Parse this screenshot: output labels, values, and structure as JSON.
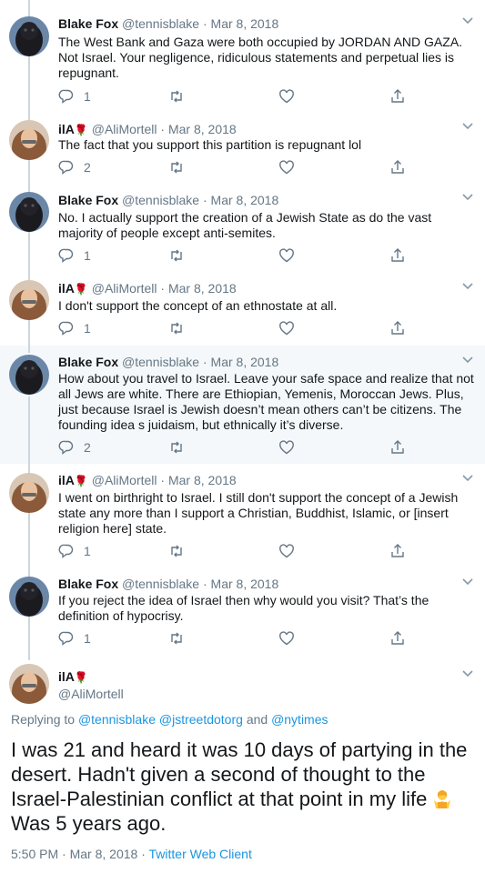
{
  "tweets": [
    {
      "name": "Blake Fox",
      "handle": "@tennisblake",
      "date": "Mar 8, 2018",
      "text": "The West Bank and Gaza were both occupied by JORDAN AND GAZA. Not Israel. Your negligence, ridiculous statements and perpetual lies is repugnant.",
      "replies": "1",
      "retweets": "",
      "likes": ""
    },
    {
      "name": "ilA",
      "name_emoji": "rose",
      "handle": "@AliMortell",
      "date": "Mar 8, 2018",
      "text": "The fact that you support this partition is repugnant lol",
      "replies": "2",
      "retweets": "",
      "likes": ""
    },
    {
      "name": "Blake Fox",
      "handle": "@tennisblake",
      "date": "Mar 8, 2018",
      "text": "No. I actually support the creation of a Jewish State as do the vast majority of people except anti-semites.",
      "replies": "1",
      "retweets": "",
      "likes": ""
    },
    {
      "name": "ilA",
      "name_emoji": "rose",
      "handle": "@AliMortell",
      "date": "Mar 8, 2018",
      "text": "I don't support the concept of an ethnostate at all.",
      "replies": "1",
      "retweets": "",
      "likes": ""
    },
    {
      "name": "Blake Fox",
      "handle": "@tennisblake",
      "date": "Mar 8, 2018",
      "text": "How about you travel to Israel. Leave your safe space and realize that not all Jews are white. There are Ethiopian, Yemenis, Moroccan Jews. Plus, just because Israel is Jewish doesn’t mean others can’t be citizens. The founding idea s juidaism, but ethnically it’s diverse.",
      "replies": "2",
      "retweets": "",
      "likes": ""
    },
    {
      "name": "ilA",
      "name_emoji": "rose",
      "handle": "@AliMortell",
      "date": "Mar 8, 2018",
      "text": "I went on birthright to Israel. I still don't support the concept of a Jewish state any more than I support a Christian, Buddhist, Islamic, or [insert religion here] state.",
      "replies": "1",
      "retweets": "",
      "likes": ""
    },
    {
      "name": "Blake Fox",
      "handle": "@tennisblake",
      "date": "Mar 8, 2018",
      "text": "If you reject the idea of Israel then why would you visit? That’s the definition of hypocrisy.",
      "replies": "1",
      "retweets": "",
      "likes": ""
    }
  ],
  "main": {
    "name": "ilA",
    "name_emoji": "rose",
    "handle": "@AliMortell",
    "replying_prefix": "Replying to",
    "replying_users": [
      "@tennisblake",
      "@jstreetdotorg",
      "@nytimes"
    ],
    "replying_and": "and",
    "text_before_emoji": "I was 21 and heard it was 10 days of partying in the desert. Hadn't given a second of thought to the Israel-Palestinian conflict at that point in my life",
    "text_emoji": "person-shrugging",
    "text_after_emoji": " Was 5 years ago.",
    "time": "5:50 PM",
    "date": "Mar 8, 2018",
    "client": "Twitter Web Client"
  },
  "colors": {
    "link": "#1b95e0",
    "secondary": "#657786",
    "highlight_bg": "#f5f8fa",
    "rose": "#c0162b"
  }
}
